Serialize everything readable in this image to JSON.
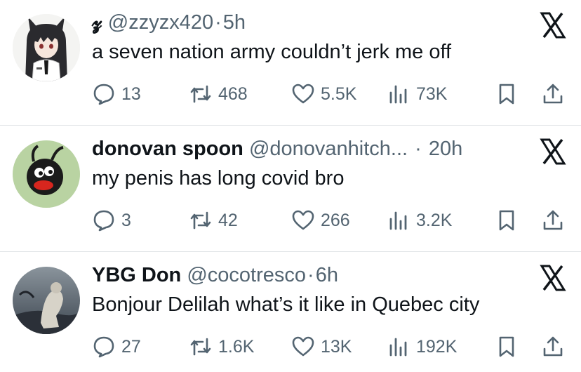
{
  "tweets": [
    {
      "name": "𝔃",
      "handle": "@zzyzx420",
      "time": "5h",
      "text": "a seven nation army couldn’t jerk me off",
      "stats": {
        "replies": "13",
        "retweets": "468",
        "likes": "5.5K",
        "views": "73K"
      }
    },
    {
      "name": "donovan spoon",
      "handle": "@donovanhitch...",
      "time": "20h",
      "text": "my penis has long covid bro",
      "stats": {
        "replies": "3",
        "retweets": "42",
        "likes": "266",
        "views": "3.2K"
      }
    },
    {
      "name": "YBG Don",
      "handle": "@cocotresco",
      "time": "6h",
      "text": "Bonjour Delilah what’s it like in Quebec city",
      "stats": {
        "replies": "27",
        "retweets": "1.6K",
        "likes": "13K",
        "views": "192K"
      }
    }
  ],
  "icons": {
    "reply": "reply-icon",
    "retweet": "retweet-icon",
    "like": "heart-icon",
    "views": "views-icon",
    "bookmark": "bookmark-icon",
    "share": "share-icon",
    "close": "x-logo-icon"
  },
  "colors": {
    "text_primary": "#0f1419",
    "text_secondary": "#536471",
    "divider": "#e1e4e7"
  }
}
